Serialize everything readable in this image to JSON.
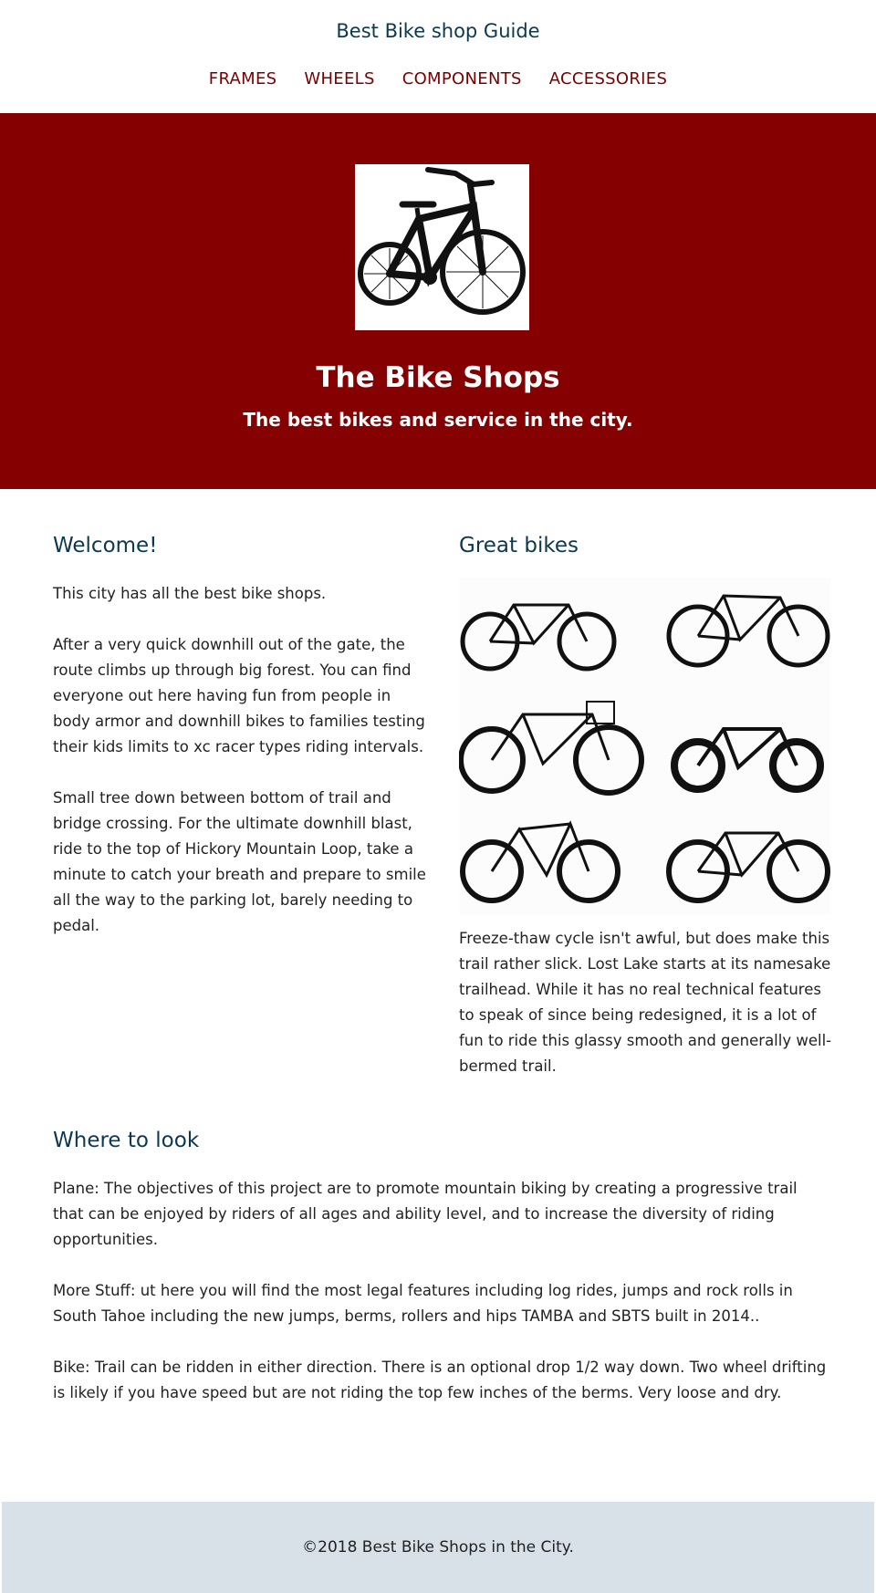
{
  "header": {
    "site_title": "Best Bike shop Guide",
    "nav": [
      "FRAMES",
      "WHEELS",
      "COMPONENTS",
      "ACCESSORIES"
    ]
  },
  "hero": {
    "image_icon": "bicycle-icon",
    "title": "The Bike Shops",
    "subtitle": "The best bikes and service in the city."
  },
  "welcome": {
    "heading": "Welcome!",
    "paragraphs": [
      "This city has all the best bike shops.",
      "After a very quick downhill out of the gate, the route climbs up through big forest. You can find everyone out here having fun from people in body armor and downhill bikes to families testing their kids limits to xc racer types riding intervals.",
      "Small tree down between bottom of trail and bridge crossing. For the ultimate downhill blast, ride to the top of Hickory Mountain Loop, take a minute to catch your breath and prepare to smile all the way to the parking lot, barely needing to pedal."
    ]
  },
  "great_bikes": {
    "heading": "Great bikes",
    "image_icon": "bicycles-grid-icon",
    "paragraph": "Freeze-thaw cycle isn't awful, but does make this trail rather slick. Lost Lake starts at its namesake trailhead. While it has no real technical features to speak of since being redesigned, it is a lot of fun to ride this glassy smooth and generally well-bermed trail."
  },
  "where": {
    "heading": "Where to look",
    "paragraphs": [
      "Plane: The objectives of this project are to promote mountain biking by creating a progressive trail that can be enjoyed by riders of all ages and ability level, and to increase the diversity of riding opportunities.",
      "More Stuff: ut here you will find the most legal features including log rides, jumps and rock rolls in South Tahoe including the new jumps, berms, rollers and hips TAMBA and SBTS built in 2014..",
      "Bike: Trail can be ridden in either direction. There is an optional drop 1/2 way down. Two wheel drifting is likely if you have speed but are not riding the top few inches of the berms. Very loose and dry."
    ]
  },
  "footer": {
    "text": "©2018 Best Bike Shops in the City."
  },
  "colors": {
    "hero_bg": "#850000",
    "nav_link": "#7a0000",
    "heading": "#0c3850",
    "footer_bg": "#d8e0e8"
  }
}
